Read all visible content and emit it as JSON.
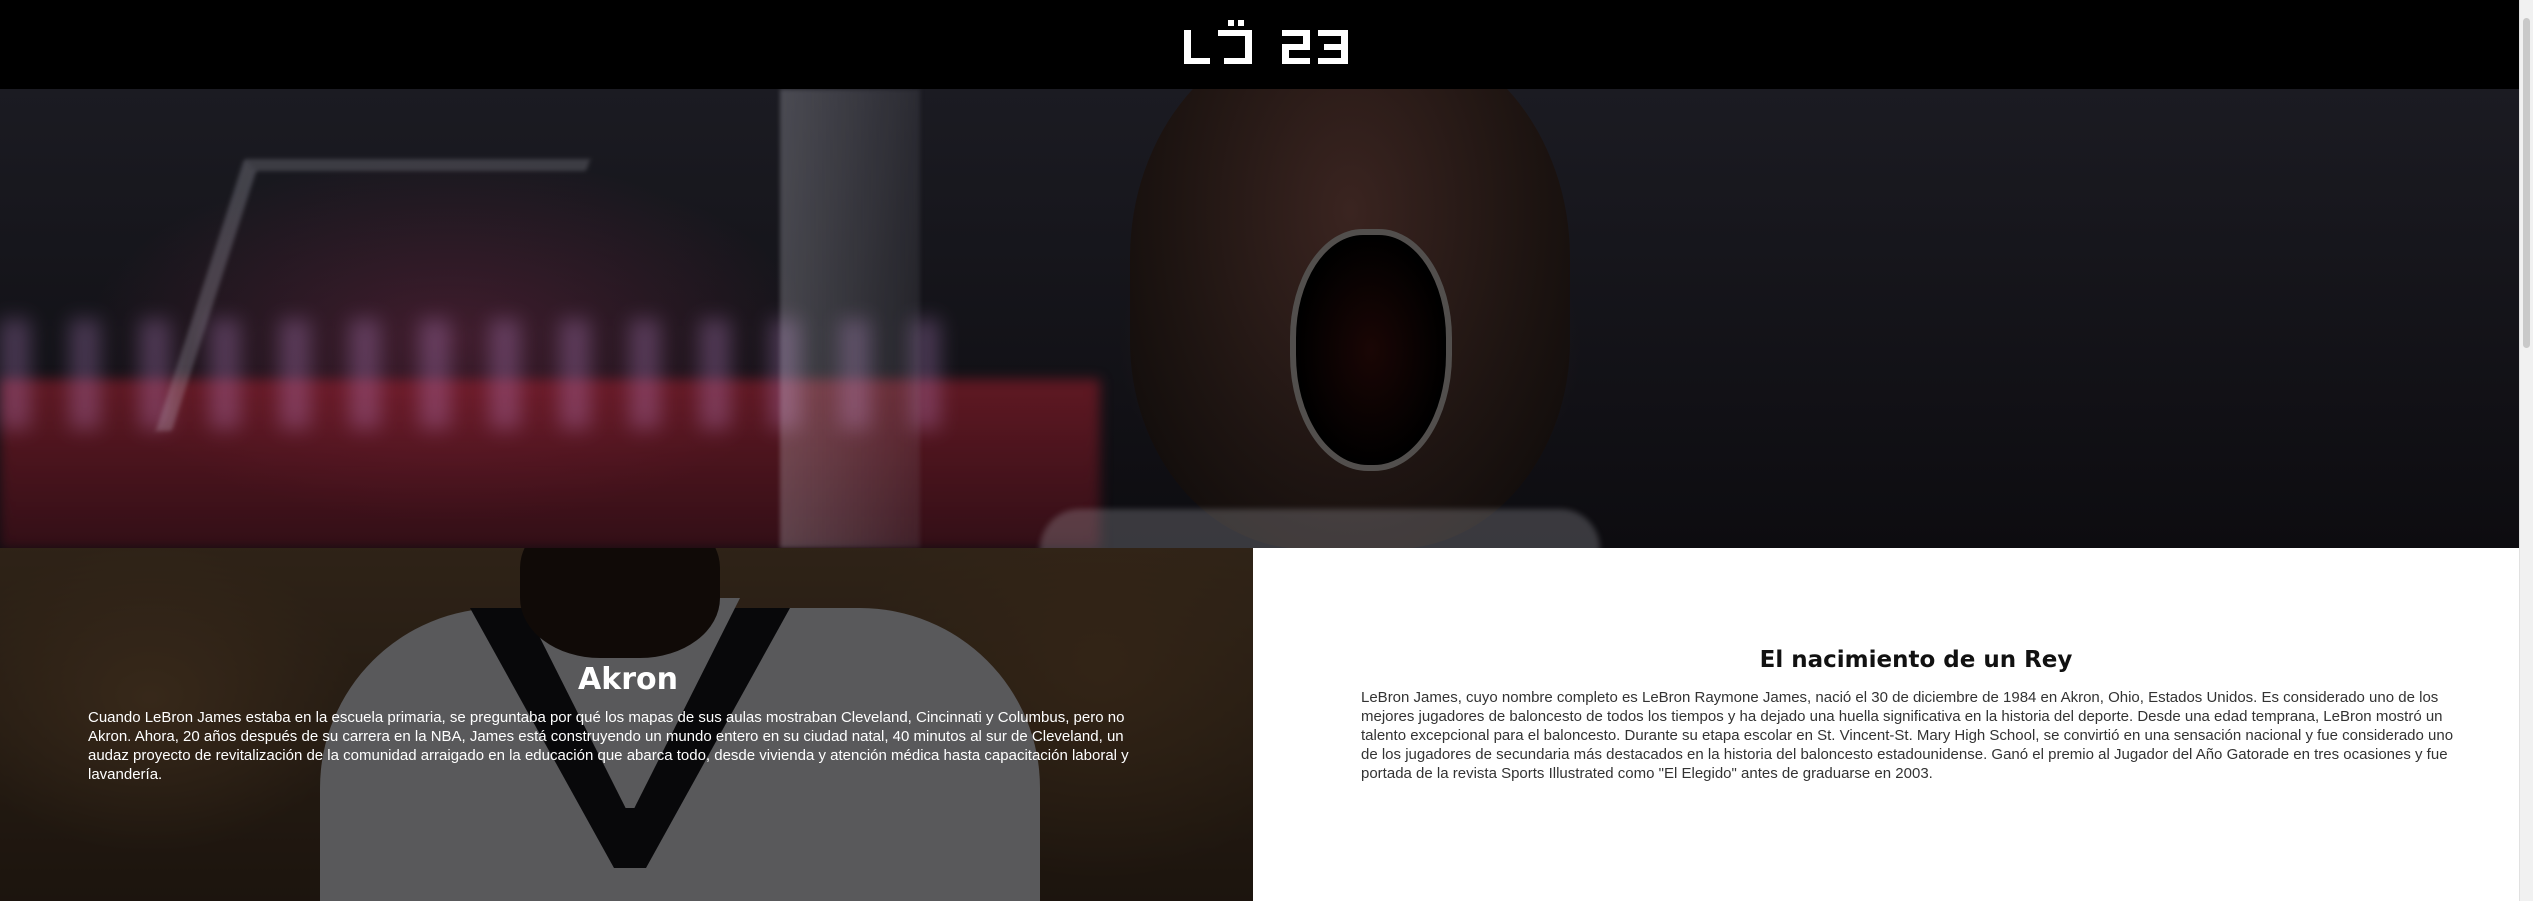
{
  "brand": {
    "logo_text": "LJ 23",
    "logo_icon": "lj23-logo-icon"
  },
  "hero": {
    "image": "hero-photo"
  },
  "sections": {
    "akron": {
      "title": "Akron",
      "text": "Cuando LeBron James estaba en la escuela primaria, se preguntaba por qué los mapas de sus aulas mostraban Cleveland, Cincinnati y Columbus, pero no Akron. Ahora, 20 años después de su carrera en la NBA, James está construyendo un mundo entero en su ciudad natal, 40 minutos al sur de Cleveland, un audaz proyecto de revitalización de la comunidad arraigado en la educación que abarca todo, desde vivienda y atención médica hasta capacitación laboral y lavandería."
    },
    "rey": {
      "title": "El nacimiento de un Rey",
      "text": "LeBron James, cuyo nombre completo es LeBron Raymone James, nació el 30 de diciembre de 1984 en Akron, Ohio, Estados Unidos. Es considerado uno de los mejores jugadores de baloncesto de todos los tiempos y ha dejado una huella significativa en la historia del deporte. Desde una edad temprana, LeBron mostró un talento excepcional para el baloncesto. Durante su etapa escolar en St. Vincent-St. Mary High School, se convirtió en una sensación nacional y fue considerado uno de los jugadores de secundaria más destacados en la historia del baloncesto estadounidense. Ganó el premio al Jugador del Año Gatorade en tres ocasiones y fue portada de la revista Sports Illustrated como \"El Elegido\" antes de graduarse en 2003."
    }
  }
}
